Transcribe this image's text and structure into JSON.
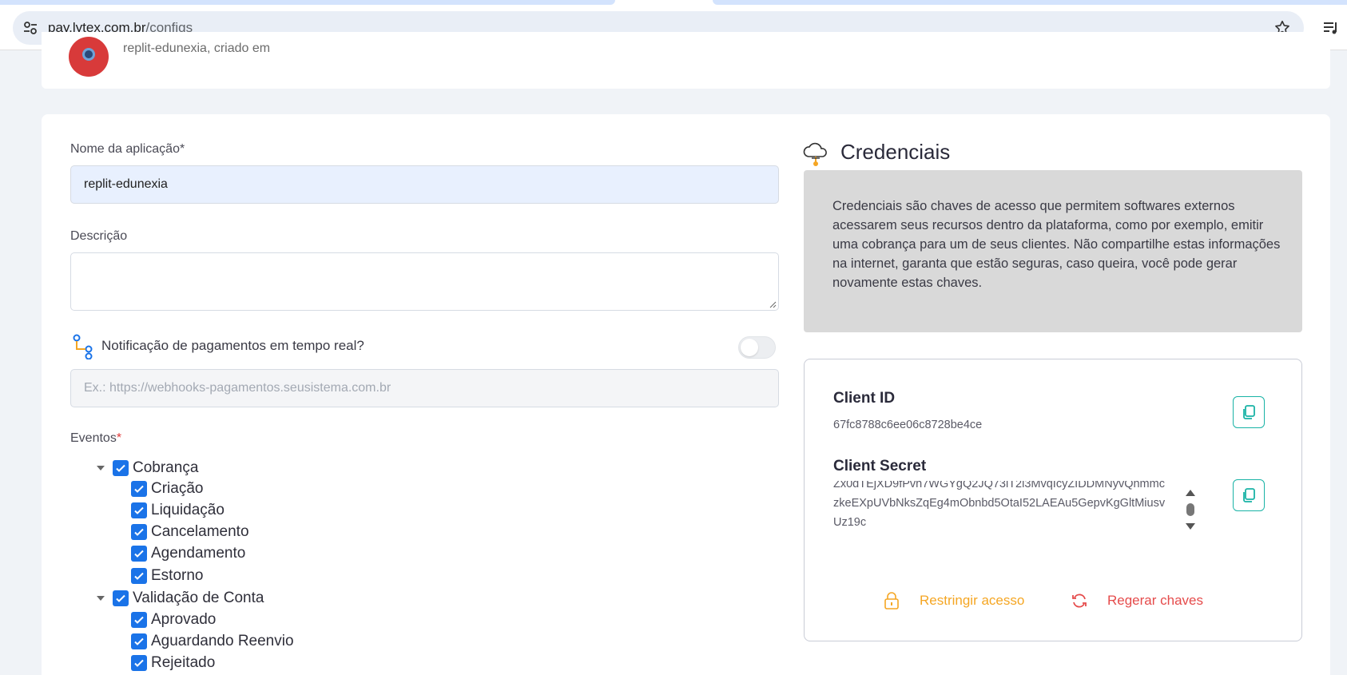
{
  "browser": {
    "url_domain": "pay.lytex.com.br",
    "url_path": "/configs"
  },
  "header": {
    "subtitle": "replit-edunexia, criado em"
  },
  "form": {
    "app_name_label": "Nome da aplicação*",
    "app_name_value": "replit-edunexia",
    "description_label": "Descrição",
    "webhook_label": "Notificação de pagamentos em tempo real?",
    "webhook_placeholder": "Ex.: https://webhooks-pagamentos.seusistema.com.br",
    "webhook_enabled": false,
    "events_label": "Eventos",
    "events_required_mark": "*",
    "events": [
      {
        "label": "Cobrança",
        "checked": true,
        "children": [
          {
            "label": "Criação",
            "checked": true
          },
          {
            "label": "Liquidação",
            "checked": true
          },
          {
            "label": "Cancelamento",
            "checked": true
          },
          {
            "label": "Agendamento",
            "checked": true
          },
          {
            "label": "Estorno",
            "checked": true
          }
        ]
      },
      {
        "label": "Validação de Conta",
        "checked": true,
        "children": [
          {
            "label": "Aprovado",
            "checked": true
          },
          {
            "label": "Aguardando Reenvio",
            "checked": true
          },
          {
            "label": "Rejeitado",
            "checked": true
          }
        ]
      }
    ]
  },
  "credentials": {
    "title": "Credenciais",
    "info": "Credenciais são chaves de acesso que permitem softwares externos acessarem seus recursos dentro da plataforma, como por exemplo, emitir uma cobrança para um de seus clientes. Não compartilhe estas informações na internet, garanta que estão seguras, caso queira, você pode gerar novamente estas chaves.",
    "client_id_label": "Client ID",
    "client_id_value": "67fc8788c6ee06c8728be4ce",
    "client_secret_label": "Client Secret",
    "client_secret_value": "Zx0dTEjXD9fPvh7WGYgQ2JQ73iT2l3MvqIcyZIDDMNyvQhmmczkeEXpUVbNksZqEg4mObnbd5OtaI52LAEAu5GepvKgGltMiusvUz19c",
    "restrict_label": "Restringir acesso",
    "regenerate_label": "Regerar chaves"
  },
  "colors": {
    "accent_blue": "#1a73e8",
    "teal": "#19b3a6",
    "orange": "#f5a623",
    "red": "#e54b4b"
  }
}
